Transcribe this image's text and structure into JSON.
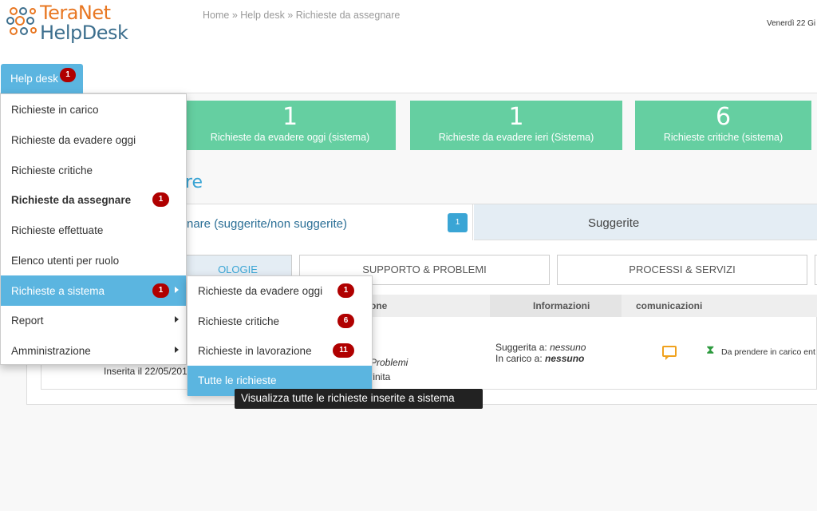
{
  "app": {
    "logo_line1": "TeraNet",
    "logo_line2": "HelpDesk"
  },
  "breadcrumb": "Home » Help desk » Richieste da assegnare",
  "date": "Venerdì 22 Gi",
  "nav": {
    "tab_label": "Help desk",
    "tab_badge": "1"
  },
  "cards": [
    {
      "value": "1",
      "label": "Richieste da evadere oggi (sistema)"
    },
    {
      "value": "1",
      "label": "Richieste da evadere ieri (Sistema)"
    },
    {
      "value": "6",
      "label": "Richieste critiche (sistema)"
    }
  ],
  "section_title": "re",
  "tabs": {
    "active_label": "nare (suggerite/non suggerite)",
    "active_badge": "1",
    "inactive_label": "Suggerite"
  },
  "categories": [
    "OLOGIE",
    "SUPPORTO & PROBLEMI",
    "PROCESSI & SERVIZI"
  ],
  "table": {
    "headers": {
      "col1": "one",
      "col2": "Informazioni",
      "col3": "comunicazioni"
    },
    "row": {
      "inserita": "Inserita il 22/05/201",
      "problemi": "Problemi",
      "finita": "finita",
      "suggerita_label": "Suggerita a:",
      "suggerita_value": "nessuno",
      "incarico_label": "In carico a:",
      "incarico_value": "nessuno",
      "stato": "Da prendere in carico ent"
    }
  },
  "menu": {
    "items": [
      {
        "label": "Richieste in carico"
      },
      {
        "label": "Richieste da evadere oggi"
      },
      {
        "label": "Richieste critiche"
      },
      {
        "label": "Richieste da assegnare",
        "badge": "1"
      },
      {
        "label": "Richieste effettuate"
      },
      {
        "label": "Elenco utenti per ruolo"
      },
      {
        "label": "Richieste a sistema",
        "badge": "1"
      },
      {
        "label": "Report"
      },
      {
        "label": "Amministrazione"
      }
    ]
  },
  "submenu": {
    "items": [
      {
        "label": "Richieste da evadere oggi",
        "badge": "1"
      },
      {
        "label": "Richieste critiche",
        "badge": "6"
      },
      {
        "label": "Richieste in lavorazione",
        "badge": "11"
      },
      {
        "label": "Tutte le richieste"
      }
    ]
  },
  "tooltip": "Visualizza tutte le richieste inserite a sistema",
  "colors": {
    "accent": "#5bb5e0",
    "card": "#65cfa1",
    "badge": "#b00000",
    "logo_orange": "#e87722",
    "logo_blue": "#3d6f8e"
  }
}
